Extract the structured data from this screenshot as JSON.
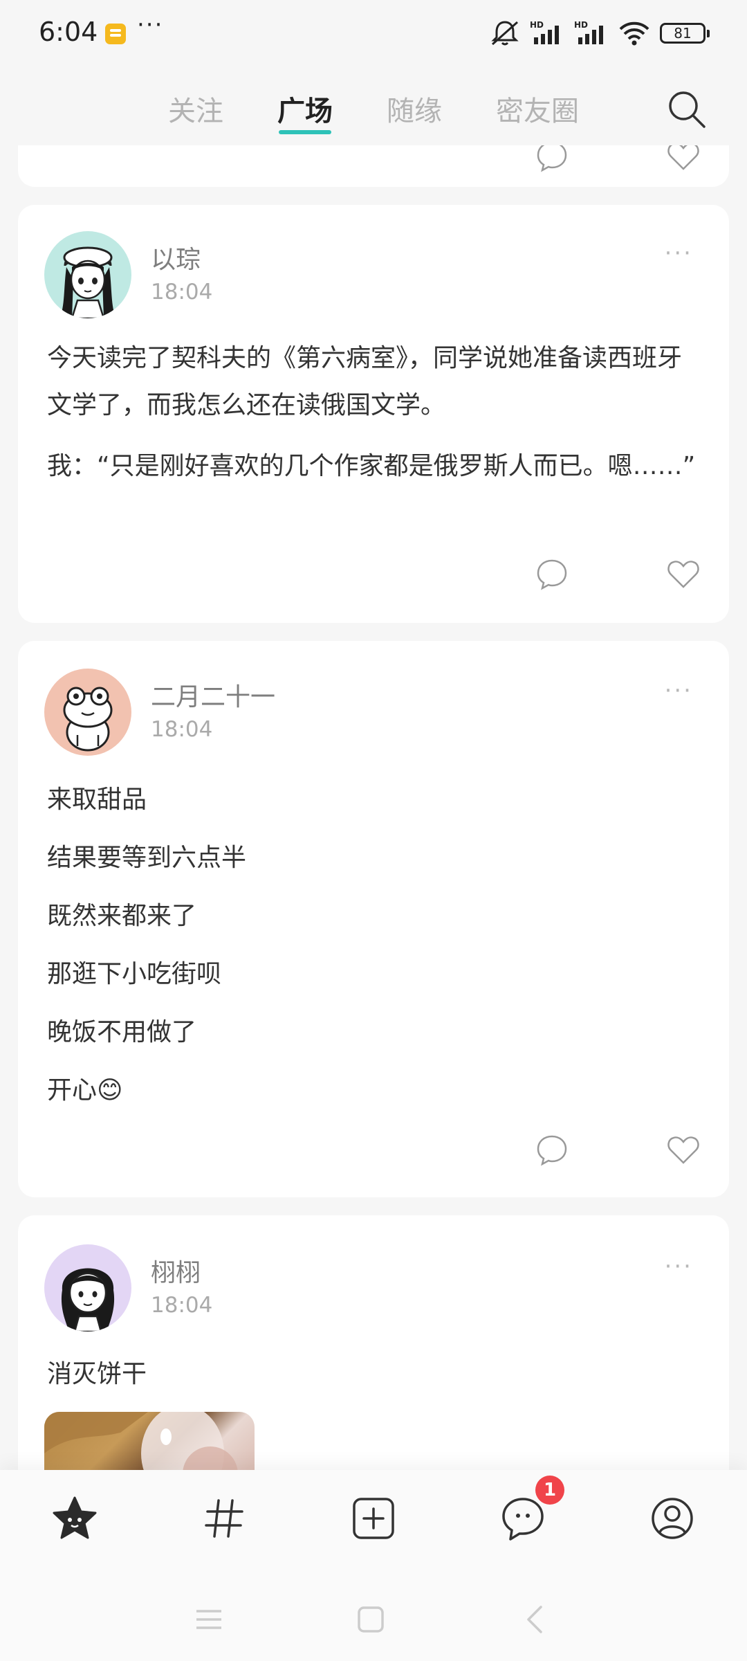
{
  "status_bar": {
    "time": "6:04",
    "battery": "81",
    "hd_label_1": "HD",
    "hd_label_2": "HD"
  },
  "top_tabs": [
    {
      "label": "关注",
      "active": false
    },
    {
      "label": "广场",
      "active": true
    },
    {
      "label": "随缘",
      "active": false
    },
    {
      "label": "密友圈",
      "active": false
    }
  ],
  "posts": [
    {
      "username": "以琮",
      "time": "18:04",
      "paragraphs": [
        "今天读完了契科夫的《第六病室》，同学说她准备读西班牙文学了，而我怎么还在读俄国文学。",
        "我：“只是刚好喜欢的几个作家都是俄罗斯人而已。嗯……”"
      ]
    },
    {
      "username": "二月二十一",
      "time": "18:04",
      "lines": [
        "来取甜品",
        "结果要等到六点半",
        "既然来都来了",
        "那逛下小吃街呗",
        "晚饭不用做了",
        "开心😊"
      ]
    },
    {
      "username": "栩栩",
      "time": "18:04",
      "lines": [
        "消灭饼干"
      ]
    }
  ],
  "bottom_nav": {
    "items": [
      "home-star-icon",
      "topic-hash-icon",
      "add-post-icon",
      "messages-icon",
      "profile-icon"
    ],
    "message_badge": "1"
  },
  "colors": {
    "accent": "#2ec2b8",
    "badge": "#f0444a",
    "avatar1_bg": "#bfe9e3",
    "avatar2_bg": "#f2c2b0",
    "avatar3_bg": "#e3d6f5"
  }
}
